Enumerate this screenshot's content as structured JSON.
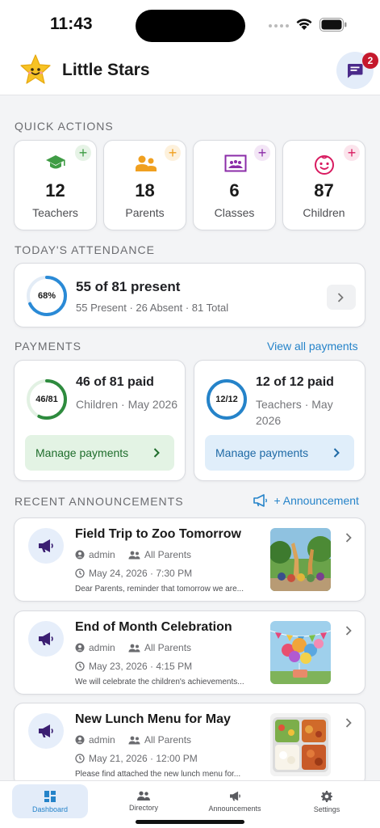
{
  "status": {
    "time": "11:43"
  },
  "header": {
    "app_title": "Little Stars",
    "messages_badge": "2"
  },
  "quick_actions": {
    "title": "QUICK ACTIONS",
    "items": [
      {
        "count": "12",
        "label": "Teachers",
        "icon": "graduation-cap-icon",
        "color": "#3f9c45"
      },
      {
        "count": "18",
        "label": "Parents",
        "icon": "family-icon",
        "color": "#f0a020"
      },
      {
        "count": "6",
        "label": "Classes",
        "icon": "classroom-icon",
        "color": "#8b2ca8"
      },
      {
        "count": "87",
        "label": "Children",
        "icon": "child-face-icon",
        "color": "#d81b60"
      }
    ]
  },
  "attendance": {
    "title": "TODAY'S ATTENDANCE",
    "percent_label": "68%",
    "percent": 0.68,
    "headline": "55 of 81 present",
    "summary": "55 Present · 26 Absent · 81 Total"
  },
  "payments": {
    "title": "PAYMENTS",
    "view_all": "View all payments",
    "cards": [
      {
        "ring_label": "46/81",
        "fraction": 0.568,
        "headline": "46 of 81 paid",
        "subtitle": "Children · May 2026",
        "button": "Manage payments",
        "color": "#2e8b3e",
        "button_bg": "#e3f3e4",
        "button_text": "#1f6d2c"
      },
      {
        "ring_label": "12/12",
        "fraction": 1.0,
        "headline": "12 of 12 paid",
        "subtitle": "Teachers · May 2026",
        "button": "Manage payments",
        "color": "#2583c9",
        "button_bg": "#e0eefa",
        "button_text": "#1f6aa6"
      }
    ]
  },
  "announcements": {
    "title": "RECENT ANNOUNCEMENTS",
    "add_label": "+ Announcement",
    "items": [
      {
        "title": "Field Trip to Zoo Tomorrow",
        "author": "admin",
        "audience": "All Parents",
        "date": "May 24, 2026 · 7:30 PM",
        "excerpt": "Dear Parents, reminder that tomorrow we are...",
        "thumb": "zoo-photo"
      },
      {
        "title": "End of Month Celebration",
        "author": "admin",
        "audience": "All Parents",
        "date": "May 23, 2026 · 4:15 PM",
        "excerpt": "We will celebrate the children's achievements...",
        "thumb": "balloons-photo"
      },
      {
        "title": "New Lunch Menu for May",
        "author": "admin",
        "audience": "All Parents",
        "date": "May 21, 2026 · 12:00 PM",
        "excerpt": "Please find attached the new lunch menu for...",
        "thumb": "lunch-tray-photo"
      }
    ]
  },
  "nav": {
    "items": [
      {
        "label": "Dashboard",
        "icon": "dashboard-icon",
        "active": true
      },
      {
        "label": "Directory",
        "icon": "people-icon",
        "active": false
      },
      {
        "label": "Announcements",
        "icon": "megaphone-icon",
        "active": false
      },
      {
        "label": "Settings",
        "icon": "gear-icon",
        "active": false
      }
    ]
  }
}
